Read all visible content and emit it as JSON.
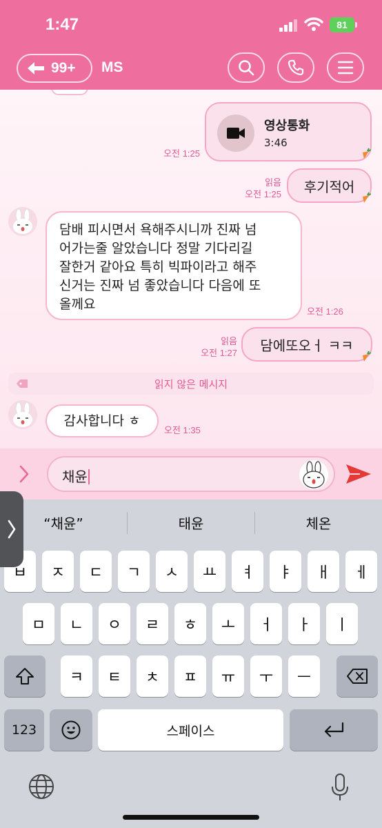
{
  "status_bar": {
    "time": "1:47",
    "battery": "81"
  },
  "header": {
    "back_count": "99+",
    "title": "MS"
  },
  "messages": {
    "video_call": {
      "title": "영상통화",
      "duration": "3:46",
      "time": "오전 1:25"
    },
    "out1": {
      "text": "후기적어",
      "read": "읽음",
      "time": "오전 1:25"
    },
    "in1": {
      "lines": [
        "담배 피시면서 욕해주시니까 진짜 넘",
        "어가는줄 알았습니다 정말 기다리길",
        "잘한거 같아요 특히 빅파이라고 해주",
        "신거는 진짜 넘 좋았습니다 다음에 또",
        "올께요"
      ],
      "time": "오전 1:26"
    },
    "out2": {
      "text": "담에또오ㅓ ㅋㅋ",
      "read": "읽음",
      "time": "오전 1:27"
    },
    "unread_divider": "읽지 않은 메시지",
    "in2": {
      "text": "감사합니다 ㅎ",
      "time": "오전 1:35"
    }
  },
  "input": {
    "value": "채윤"
  },
  "keyboard": {
    "suggestions": [
      "“채윤”",
      "태윤",
      "체온"
    ],
    "row1": [
      "ㅂ",
      "ㅈ",
      "ㄷ",
      "ㄱ",
      "ㅅ",
      "ㅛ",
      "ㅕ",
      "ㅑ",
      "ㅐ",
      "ㅔ"
    ],
    "row2": [
      "ㅁ",
      "ㄴ",
      "ㅇ",
      "ㄹ",
      "ㅎ",
      "ㅗ",
      "ㅓ",
      "ㅏ",
      "ㅣ"
    ],
    "row3": [
      "ㅋ",
      "ㅌ",
      "ㅊ",
      "ㅍ",
      "ㅠ",
      "ㅜ",
      "ㅡ"
    ],
    "num_key": "123",
    "space_label": "스페이스"
  },
  "colors": {
    "header_pink": "#ee6f9e",
    "accent": "#e6588f",
    "send_red": "#e53935"
  },
  "icons": [
    "back-arrow-icon",
    "search-icon",
    "phone-icon",
    "menu-icon",
    "video-camera-icon",
    "carrot-icon",
    "chevron-right-icon",
    "send-icon",
    "shift-icon",
    "backspace-icon",
    "emoji-icon",
    "return-icon",
    "globe-icon",
    "microphone-icon"
  ]
}
